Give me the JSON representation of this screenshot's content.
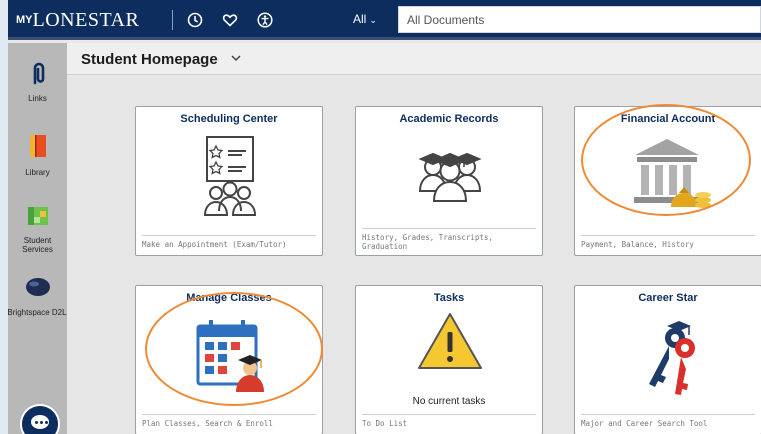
{
  "header": {
    "logo_prefix": "MY",
    "logo_main": "LONESTAR",
    "scope_label": "All",
    "search_placeholder": "All Documents",
    "icons": [
      "history-icon",
      "favorites-heart-icon",
      "accessibility-icon"
    ]
  },
  "sidebar": {
    "items": [
      {
        "label": "Links",
        "icon": "links-icon"
      },
      {
        "label": "Library",
        "icon": "library-book-icon"
      },
      {
        "label": "Student Services",
        "icon": "student-services-icon"
      },
      {
        "label": "Brightspace D2L",
        "icon": "brightspace-icon"
      }
    ]
  },
  "page": {
    "title": "Student Homepage"
  },
  "tiles": [
    {
      "title": "Scheduling Center",
      "footer": "Make an Appointment (Exam/Tutor)",
      "icon": "scheduling-checklist-icon"
    },
    {
      "title": "Academic Records",
      "footer": "History, Grades, Transcripts, Graduation",
      "icon": "graduates-group-icon"
    },
    {
      "title": "Financial Account",
      "footer": "Payment, Balance, History",
      "icon": "bank-money-icon"
    },
    {
      "title": "Manage Classes",
      "footer": "Plan Classes, Search & Enroll",
      "icon": "calendar-graduate-icon"
    },
    {
      "title": "Tasks",
      "footer": "To Do List",
      "note": "No current tasks",
      "icon": "warning-icon"
    },
    {
      "title": "Career Star",
      "footer": "Major and Career Search Tool",
      "icon": "keys-graduation-icon"
    }
  ],
  "colors": {
    "brand_navy": "#0c2d5e",
    "highlight_orange": "#ee8a34",
    "tile_title": "#0c2d5e"
  }
}
